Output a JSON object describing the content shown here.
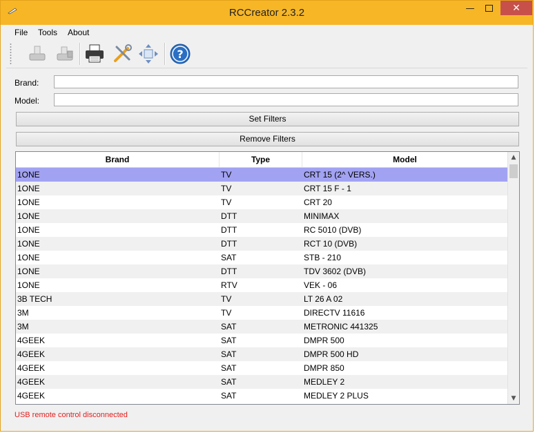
{
  "window": {
    "title": "RCCreator 2.3.2"
  },
  "menu": [
    "File",
    "Tools",
    "About"
  ],
  "toolbar": {
    "buttons": [
      {
        "name": "read-remote-icon"
      },
      {
        "name": "write-remote-icon"
      },
      {
        "name": "printer-icon"
      },
      {
        "name": "settings-tools-icon"
      },
      {
        "name": "move-arrows-icon"
      },
      {
        "name": "help-icon"
      }
    ]
  },
  "filters": {
    "brand_label": "Brand:",
    "brand_value": "",
    "model_label": "Model:",
    "model_value": "",
    "set_filters": "Set Filters",
    "remove_filters": "Remove Filters"
  },
  "table": {
    "columns": [
      "Brand",
      "Type",
      "Model"
    ],
    "rows": [
      [
        "1ONE",
        "TV",
        "CRT 15 (2^ VERS.)"
      ],
      [
        "1ONE",
        "TV",
        "CRT 15 F - 1"
      ],
      [
        "1ONE",
        "TV",
        "CRT 20"
      ],
      [
        "1ONE",
        "DTT",
        "MINIMAX"
      ],
      [
        "1ONE",
        "DTT",
        "RC 5010 (DVB)"
      ],
      [
        "1ONE",
        "DTT",
        "RCT 10 (DVB)"
      ],
      [
        "1ONE",
        "SAT",
        "STB - 210"
      ],
      [
        "1ONE",
        "DTT",
        "TDV 3602 (DVB)"
      ],
      [
        "1ONE",
        "RTV",
        "VEK - 06"
      ],
      [
        "3B TECH",
        "TV",
        "LT 26 A 02"
      ],
      [
        "3M",
        "TV",
        "DIRECTV 11616"
      ],
      [
        "3M",
        "SAT",
        "METRONIC 441325"
      ],
      [
        "4GEEK",
        "SAT",
        "DMPR 500"
      ],
      [
        "4GEEK",
        "SAT",
        "DMPR 500 HD"
      ],
      [
        "4GEEK",
        "SAT",
        "DMPR 850"
      ],
      [
        "4GEEK",
        "SAT",
        "MEDLEY 2"
      ],
      [
        "4GEEK",
        "SAT",
        "MEDLEY 2 PLUS"
      ]
    ],
    "selected_row": 0
  },
  "status": "USB remote control disconnected",
  "colors": {
    "titlebar": "#f6b626",
    "selection": "#a2a2f2",
    "status_text": "#e02020",
    "close_button": "#c7504a"
  }
}
